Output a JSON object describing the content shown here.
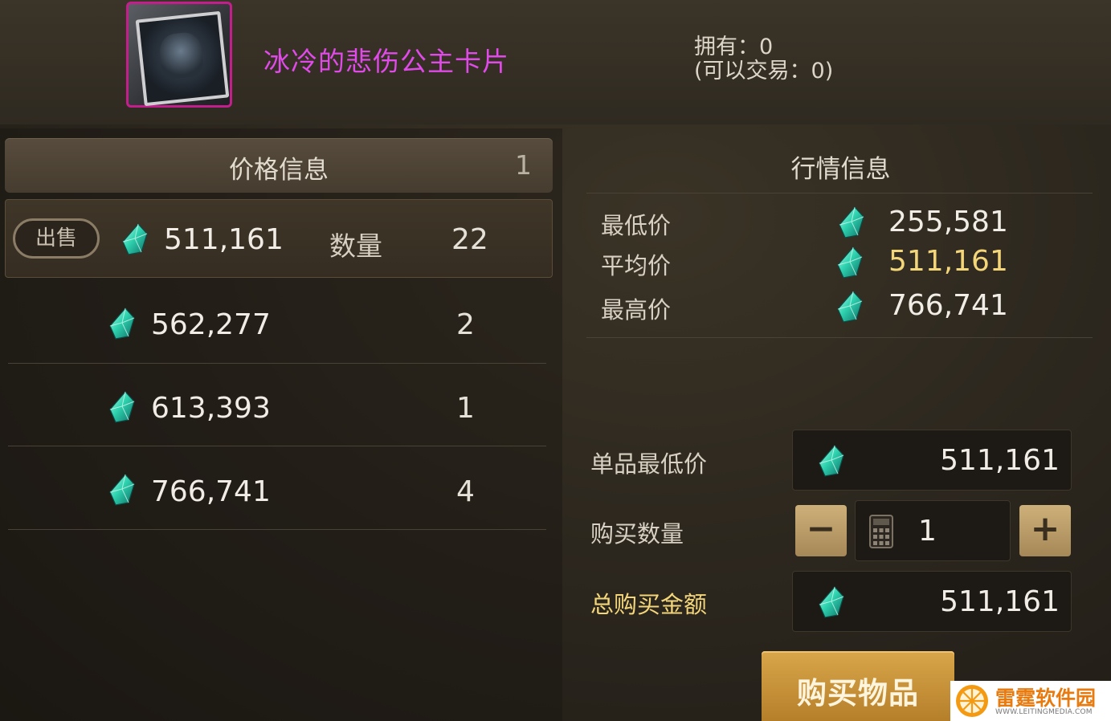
{
  "item": {
    "name": "冰冷的悲伤公主卡片",
    "owned_line": "拥有：0",
    "tradable_line": "(可以交易：0)",
    "icon": "princess-card-icon"
  },
  "price_info": {
    "title": "价格信息",
    "page": "1",
    "sell_label": "出售",
    "qty_label": "数量",
    "listings": [
      {
        "price": "511,161",
        "qty": "22"
      },
      {
        "price": "562,277",
        "qty": "2"
      },
      {
        "price": "613,393",
        "qty": "1"
      },
      {
        "price": "766,741",
        "qty": "4"
      }
    ]
  },
  "market_info": {
    "title": "行情信息",
    "rows": [
      {
        "label": "最低价",
        "value": "255,581"
      },
      {
        "label": "平均价",
        "value": "511,161"
      },
      {
        "label": "最高价",
        "value": "766,741"
      }
    ]
  },
  "purchase": {
    "unit_price_label": "单品最低价",
    "unit_price": "511,161",
    "qty_label": "购买数量",
    "qty": "1",
    "minus": "−",
    "plus": "+",
    "total_label": "总购买金额",
    "total": "511,161",
    "buy_button": "购买物品"
  },
  "watermark": {
    "title": "雷霆软件园",
    "url": "WWW.LEITINGMEDIA.COM"
  },
  "colors": {
    "item_name": "#e04ae8",
    "gold_text": "#f3d57a",
    "buy_button": "#d9a64a",
    "gem": "#2fd3b0"
  }
}
